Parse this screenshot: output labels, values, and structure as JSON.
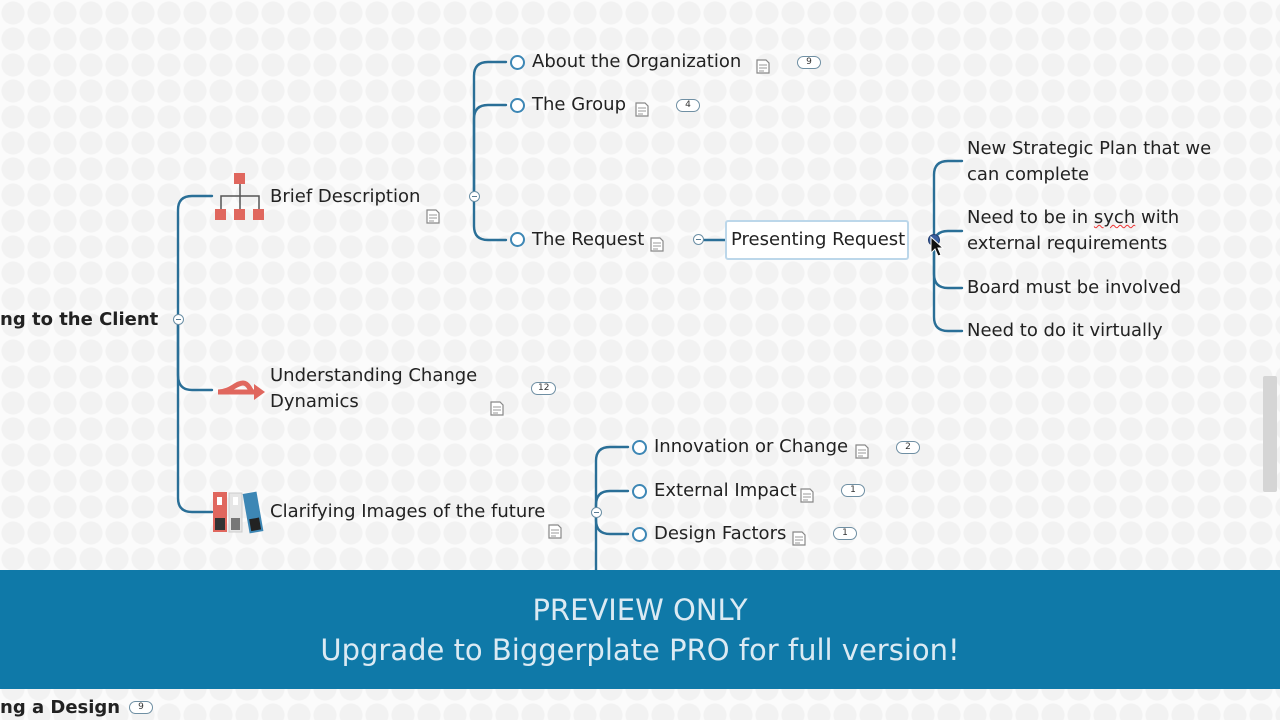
{
  "colors": {
    "connector": "#2a6f97",
    "banner_bg": "#0f79a8",
    "banner_text": "#dbeaf3",
    "icon_red": "#e0675e",
    "bubble": "#3d87b5"
  },
  "map": {
    "root_label": "ng to the Client",
    "bottom_label": "ng a Design",
    "bottom_badge": "9",
    "branches": {
      "brief": {
        "label": "Brief Description",
        "icon": "org-chart-icon",
        "children": {
          "about": {
            "label": "About the Organization",
            "badge": "9"
          },
          "group": {
            "label": "The Group",
            "badge": "4"
          },
          "request": {
            "label": "The Request"
          }
        },
        "presenting": {
          "label": "Presenting Request",
          "items": [
            "New Strategic Plan that we can complete",
            "Need to be in ",
            "sych",
            " with external requirements",
            "Board must be involved",
            "Need to do it virtually"
          ]
        }
      },
      "change": {
        "label_line1": "Understanding Change",
        "label_line2": "Dynamics",
        "badge": "12",
        "icon": "split-arrow-icon"
      },
      "future": {
        "label": "Clarifying Images of the future",
        "icon": "binders-icon",
        "children": {
          "innovation": {
            "label": "Innovation or Change",
            "badge": "2"
          },
          "external": {
            "label": "External Impact",
            "badge": "1"
          },
          "design": {
            "label": "Design Factors",
            "badge": "1"
          }
        }
      }
    }
  },
  "banner": {
    "line1": "PREVIEW ONLY",
    "line2": "Upgrade to Biggerplate PRO for full version!"
  }
}
